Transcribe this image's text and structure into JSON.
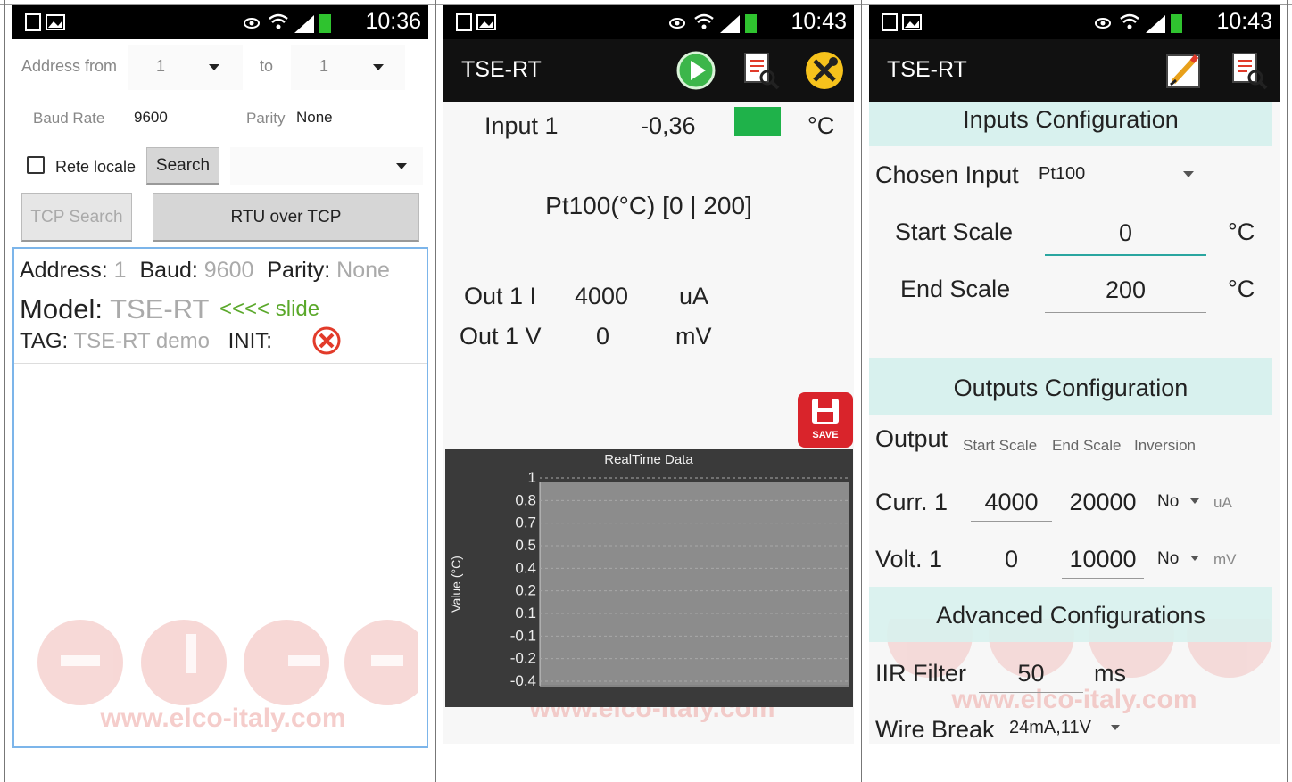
{
  "status": {
    "panel1_time": "10:36",
    "panel2_time": "10:43",
    "panel3_time": "10:43"
  },
  "panel1": {
    "address_from_label": "Address from",
    "address_from_value": "1",
    "to_label": "to",
    "to_value": "1",
    "baud_label": "Baud Rate",
    "baud_value": "9600",
    "parity_label": "Parity",
    "parity_value": "None",
    "rete_locale_label": "Rete locale",
    "search_button": "Search",
    "tcp_search_button": "TCP Search",
    "rtu_over_tcp_button": "RTU over TCP",
    "device": {
      "address_label": "Address:",
      "address_value": "1",
      "baud_label": "Baud:",
      "baud_value": "9600",
      "parity_label": "Parity:",
      "parity_value": "None",
      "model_label": "Model:",
      "model_value": "TSE-RT",
      "slide_hint": "<<<< slide",
      "tag_label": "TAG:",
      "tag_value": "TSE-RT demo",
      "init_label": "INIT:"
    },
    "watermark_url": "www.elco-italy.com"
  },
  "panel2": {
    "title": "TSE-RT",
    "input_label": "Input 1",
    "input_value": "-0,36",
    "input_unit": "°C",
    "status_color": "#1fb24a",
    "sensor_range": "Pt100(°C) [0 | 200]",
    "out_i_label": "Out 1 I",
    "out_i_value": "4000",
    "out_i_unit": "uA",
    "out_v_label": "Out 1 V",
    "out_v_value": "0",
    "out_v_unit": "mV",
    "save_label": "SAVE",
    "watermark_url": "www.elco-italy.com",
    "chart_data": {
      "type": "line",
      "title": "RealTime Data",
      "ylabel": "Value (°C)",
      "xlabel": "",
      "yticks": [
        "1",
        "0.8",
        "0.7",
        "0.5",
        "0.4",
        "0.2",
        "0.1",
        "-0.1",
        "-0.2",
        "-0.4"
      ],
      "series": [],
      "grid": true
    }
  },
  "panel3": {
    "title": "TSE-RT",
    "inputs_header": "Inputs Configuration",
    "chosen_input_label": "Chosen Input",
    "chosen_input_value": "Pt100",
    "start_scale_label": "Start Scale",
    "start_scale_value": "0",
    "start_scale_unit": "°C",
    "end_scale_label": "End Scale",
    "end_scale_value": "200",
    "end_scale_unit": "°C",
    "outputs_header": "Outputs Configuration",
    "output_label": "Output",
    "col_start": "Start Scale",
    "col_end": "End Scale",
    "col_inversion": "Inversion",
    "curr_label": "Curr. 1",
    "curr_start": "4000",
    "curr_end": "20000",
    "curr_inversion": "No",
    "curr_unit": "uA",
    "volt_label": "Volt. 1",
    "volt_start": "0",
    "volt_end": "10000",
    "volt_inversion": "No",
    "volt_unit": "mV",
    "advanced_header": "Advanced Configurations",
    "iir_label": "IIR Filter",
    "iir_value": "50",
    "iir_unit": "ms",
    "wire_break_label": "Wire Break",
    "wire_break_value": "24mA,11V",
    "watermark_url": "www.elco-italy.com"
  }
}
